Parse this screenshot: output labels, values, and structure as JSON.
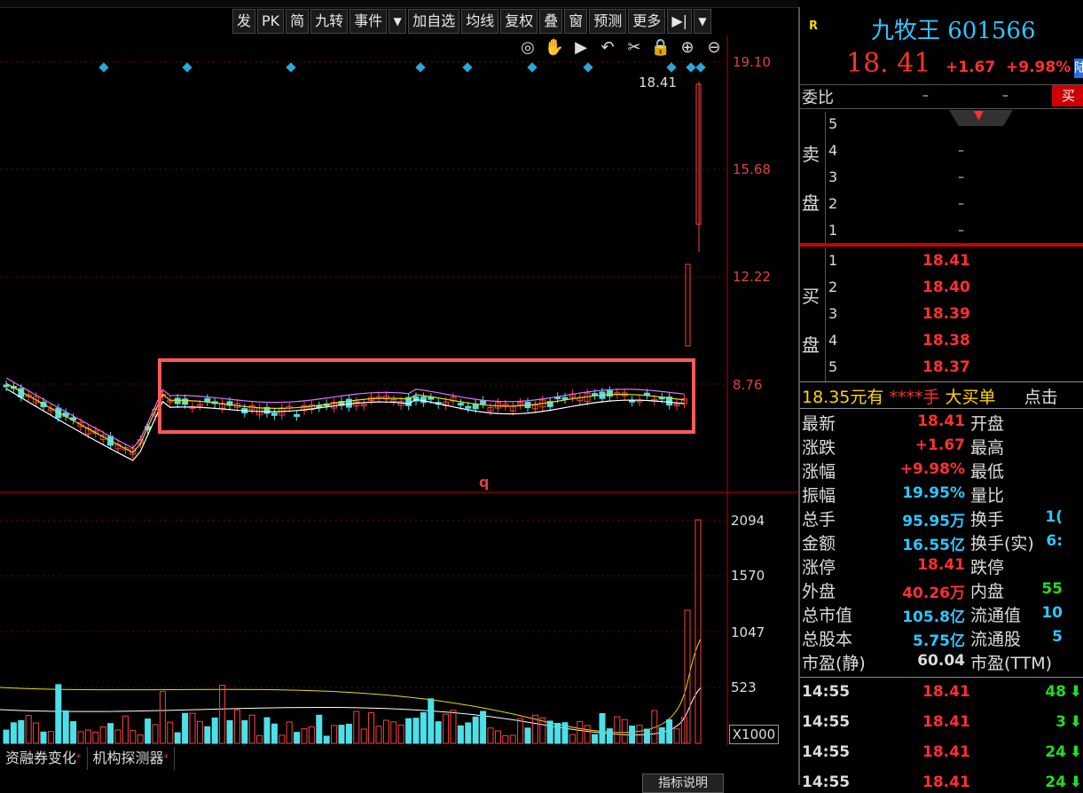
{
  "toolbar": {
    "items": [
      "发",
      "PK",
      "简",
      "九转",
      "事件",
      "▼",
      "加自选",
      "均线",
      "复权",
      "叠",
      "窗",
      "预测",
      "更多",
      "▶|",
      "▼"
    ]
  },
  "chart_controls": [
    "eye-icon",
    "hand-icon",
    "play-icon",
    "undo-icon",
    "scissors-icon",
    "lock-icon",
    "zoom-in-icon",
    "zoom-out-icon"
  ],
  "price_axis": [
    "19.10",
    "15.68",
    "12.22",
    "8.76"
  ],
  "volume_axis": [
    "2094",
    "1570",
    "1047",
    "523"
  ],
  "volume_unit": "X1000",
  "last_price_tag": "18.41",
  "chart_marker": "q",
  "bottom_tabs": [
    "资融券变化",
    "机构探测器"
  ],
  "indicator_help": "指标说明",
  "quote": {
    "badge": "R",
    "name": "九牧王 601566",
    "price": "18. 41",
    "change": "+1.67",
    "change_pct": "+9.98%",
    "board_badge": "陆"
  },
  "order_book": {
    "weibi_label": "委比",
    "weibi_values": [
      "–",
      "–"
    ],
    "buy_button": "买",
    "sell_side_label": [
      "卖",
      "盘"
    ],
    "buy_side_label": [
      "买",
      "盘"
    ],
    "asks": [
      {
        "level": "5",
        "price": ""
      },
      {
        "level": "4",
        "price": "–"
      },
      {
        "level": "3",
        "price": "–"
      },
      {
        "level": "2",
        "price": "–"
      },
      {
        "level": "1",
        "price": "–"
      }
    ],
    "bids": [
      {
        "level": "1",
        "price": "18.41"
      },
      {
        "level": "2",
        "price": "18.40"
      },
      {
        "level": "3",
        "price": "18.39"
      },
      {
        "level": "4",
        "price": "18.38"
      },
      {
        "level": "5",
        "price": "18.37"
      }
    ]
  },
  "big_order": {
    "price": "18.35元有",
    "hands": "****手",
    "label": "大买单",
    "action": "点击"
  },
  "stats": [
    {
      "label": "最新",
      "value": "18.41",
      "color": "red",
      "label2": "开盘",
      "value2": ""
    },
    {
      "label": "涨跌",
      "value": "+1.67",
      "color": "red",
      "label2": "最高",
      "value2": ""
    },
    {
      "label": "涨幅",
      "value": "+9.98%",
      "color": "red",
      "label2": "最低",
      "value2": ""
    },
    {
      "label": "振幅",
      "value": "19.95%",
      "color": "cyan",
      "label2": "量比",
      "value2": ""
    },
    {
      "label": "总手",
      "value": "95.95万",
      "color": "cyan",
      "label2": "换手",
      "value2": "1("
    },
    {
      "label": "金额",
      "value": "16.55亿",
      "color": "cyan",
      "label2": "换手(实)",
      "value2": "6:"
    },
    {
      "label": "涨停",
      "value": "18.41",
      "color": "red",
      "label2": "跌停",
      "value2": ""
    },
    {
      "label": "外盘",
      "value": "40.26万",
      "color": "red",
      "label2": "内盘",
      "value2": "55"
    },
    {
      "label": "总市值",
      "value": "105.8亿",
      "color": "cyan",
      "label2": "流通值",
      "value2": "10"
    },
    {
      "label": "总股本",
      "value": "5.75亿",
      "color": "cyan",
      "label2": "流通股",
      "value2": "5"
    },
    {
      "label": "市盈(静)",
      "value": "60.04",
      "color": "white",
      "label2": "市盈(TTM)",
      "value2": ""
    }
  ],
  "ticks": [
    {
      "time": "14:55",
      "price": "18.41",
      "vol": "48"
    },
    {
      "time": "14:55",
      "price": "18.41",
      "vol": "3"
    },
    {
      "time": "14:55",
      "price": "18.41",
      "vol": "24"
    },
    {
      "time": "14:55",
      "price": "18.41",
      "vol": "24"
    }
  ]
}
